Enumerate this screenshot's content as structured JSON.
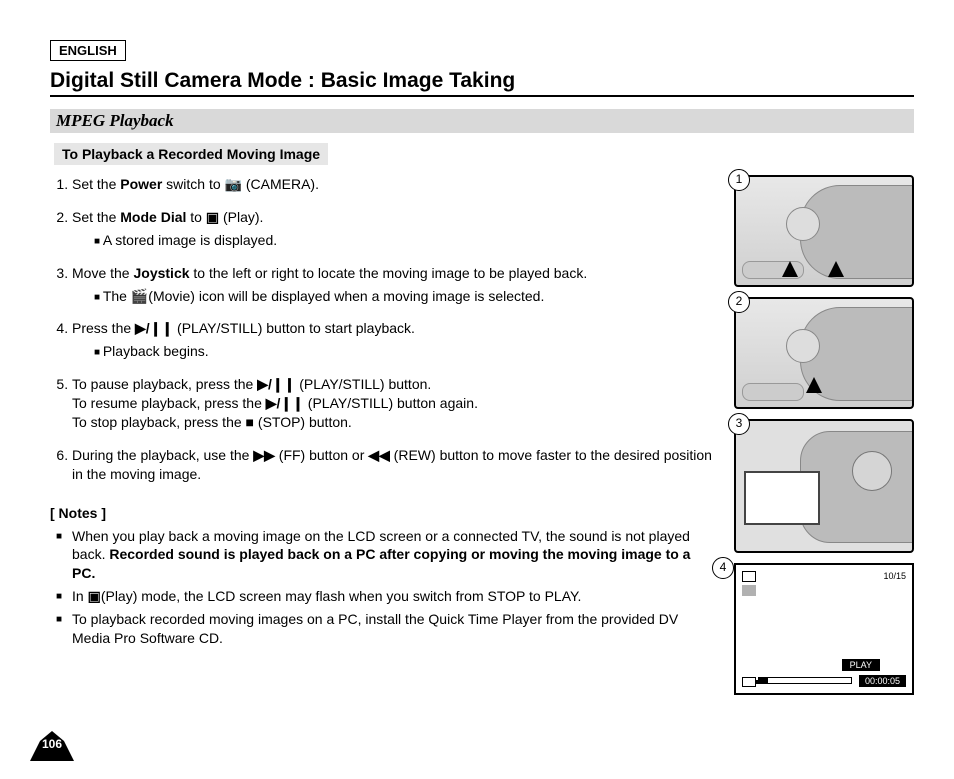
{
  "header": {
    "language": "ENGLISH",
    "title": "Digital Still Camera Mode : Basic Image Taking",
    "section": "MPEG Playback",
    "subsection": "To Playback a Recorded Moving Image"
  },
  "steps": {
    "s1_a": "Set the ",
    "s1_b": "Power",
    "s1_c": " switch to ",
    "s1_icon": "camera-icon",
    "s1_d": "(CAMERA).",
    "s2_a": "Set the ",
    "s2_b": "Mode Dial",
    "s2_c": " to ",
    "s2_icon": "play-mode-icon",
    "s2_d": "(Play).",
    "s2_sub": "A stored image is displayed.",
    "s3_a": "Move the ",
    "s3_b": "Joystick",
    "s3_c": " to the left or right to locate the moving image to be played back.",
    "s3_sub_a": "The ",
    "s3_sub_icon": "movie-icon",
    "s3_sub_b": "(Movie) icon will be displayed when a moving image is selected.",
    "s4_a": "Press the ",
    "s4_icon": "▶/❙❙",
    "s4_b": "(PLAY/STILL) button to start playback.",
    "s4_sub": "Playback begins.",
    "s5_a": "To pause playback, press the ",
    "s5_icon1": "▶/❙❙",
    "s5_b": " (PLAY/STILL) button.",
    "s5_c": "To resume playback, press the ",
    "s5_icon2": "▶/❙❙",
    "s5_d": " (PLAY/STILL) button again.",
    "s5_e": "To stop playback, press the ",
    "s5_icon3": "■",
    "s5_f": " (STOP) button.",
    "s6_a": "During the playback, use the ",
    "s6_icon1": "▶▶",
    "s6_b": " (FF) button or ",
    "s6_icon2": "◀◀",
    "s6_c": " (REW) button to move faster to the desired position in the moving image."
  },
  "notes": {
    "heading": "[ Notes ]",
    "n1_a": "When you play back a moving image on the LCD screen or a connected TV, the sound is not played back. ",
    "n1_b": "Recorded sound is played back on a PC after copying or moving the moving image to a PC.",
    "n2_a": "In ",
    "n2_icon": "play-mode-icon",
    "n2_b": "(Play) mode, the LCD screen may flash when you switch from STOP to PLAY.",
    "n3": "To playback recorded moving images on a PC, install the Quick Time Player from the provided DV Media Pro Software CD."
  },
  "figures": {
    "f1": "1",
    "f2": "2",
    "f3": "3",
    "f4": "4"
  },
  "screen": {
    "counter": "10/15",
    "play_label": "PLAY",
    "time": "00:00:05"
  },
  "page_number": "106"
}
